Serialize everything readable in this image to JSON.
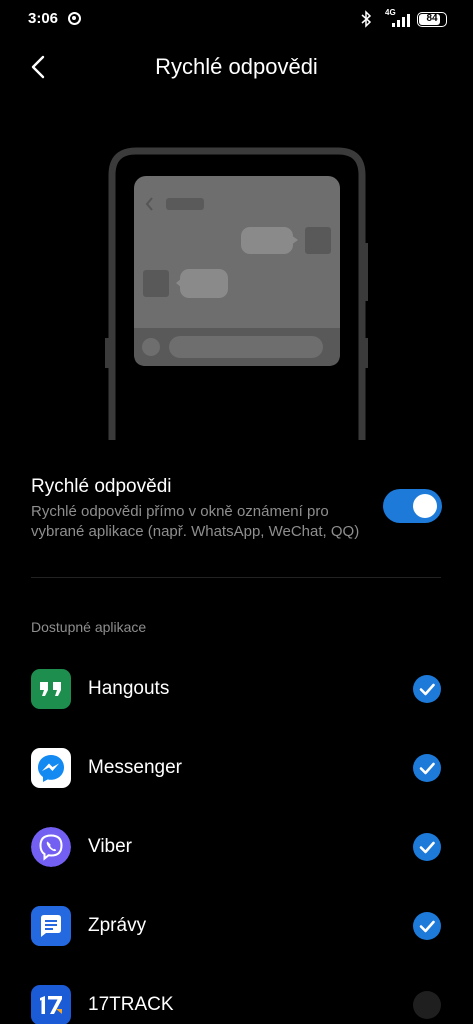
{
  "status_bar": {
    "time": "3:06",
    "network": "4G",
    "battery": "84",
    "battery_level": 0.84
  },
  "header": {
    "title": "Rychlé odpovědi"
  },
  "toggle": {
    "title": "Rychlé odpovědi",
    "description": "Rychlé odpovědi přímo v okně oznámení pro vybrané aplikace (např. WhatsApp, WeChat, QQ)",
    "enabled": true
  },
  "section": {
    "header": "Dostupné aplikace"
  },
  "apps": [
    {
      "label": "Hangouts",
      "icon": "hangouts-icon",
      "checked": true
    },
    {
      "label": "Messenger",
      "icon": "messenger-icon",
      "checked": true
    },
    {
      "label": "Viber",
      "icon": "viber-icon",
      "checked": true
    },
    {
      "label": "Zprávy",
      "icon": "messages-icon",
      "checked": true
    },
    {
      "label": "17TRACK",
      "icon": "17track-icon",
      "checked": false
    }
  ],
  "colors": {
    "accent": "#1d7ad9",
    "background": "#000000",
    "secondary_text": "#8e8e8e"
  }
}
